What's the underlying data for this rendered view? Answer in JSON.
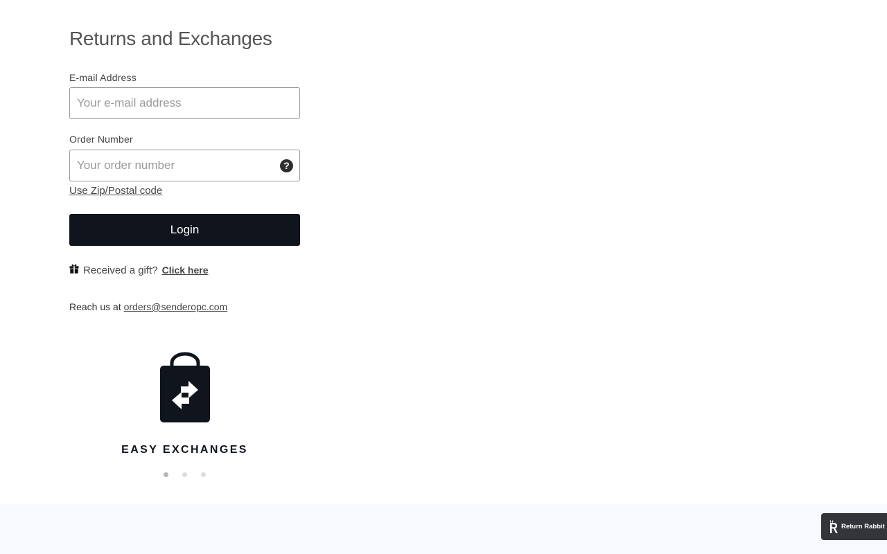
{
  "page": {
    "title": "Returns and Exchanges"
  },
  "form": {
    "email": {
      "label": "E-mail Address",
      "placeholder": "Your e-mail address",
      "value": ""
    },
    "order": {
      "label": "Order Number",
      "placeholder": "Your order number",
      "value": "",
      "help_icon": "?"
    },
    "zip_link": "Use Zip/Postal code",
    "login_button": "Login"
  },
  "gift": {
    "icon": "gift-icon",
    "text": "Received a gift?",
    "link": "Click here"
  },
  "contact": {
    "prefix": "Reach us at ",
    "email": "orders@senderopc.com"
  },
  "carousel": {
    "icon": "shopping-bag-exchange-icon",
    "caption": "EASY EXCHANGES",
    "slide_count": 3,
    "active_index": 0
  },
  "badge": {
    "icon": "return-rabbit-logo",
    "label": "Return Rabbit"
  },
  "colors": {
    "primary": "#0f141d",
    "footer_bg": "#f8f9fc",
    "badge_bg": "#34353a"
  }
}
